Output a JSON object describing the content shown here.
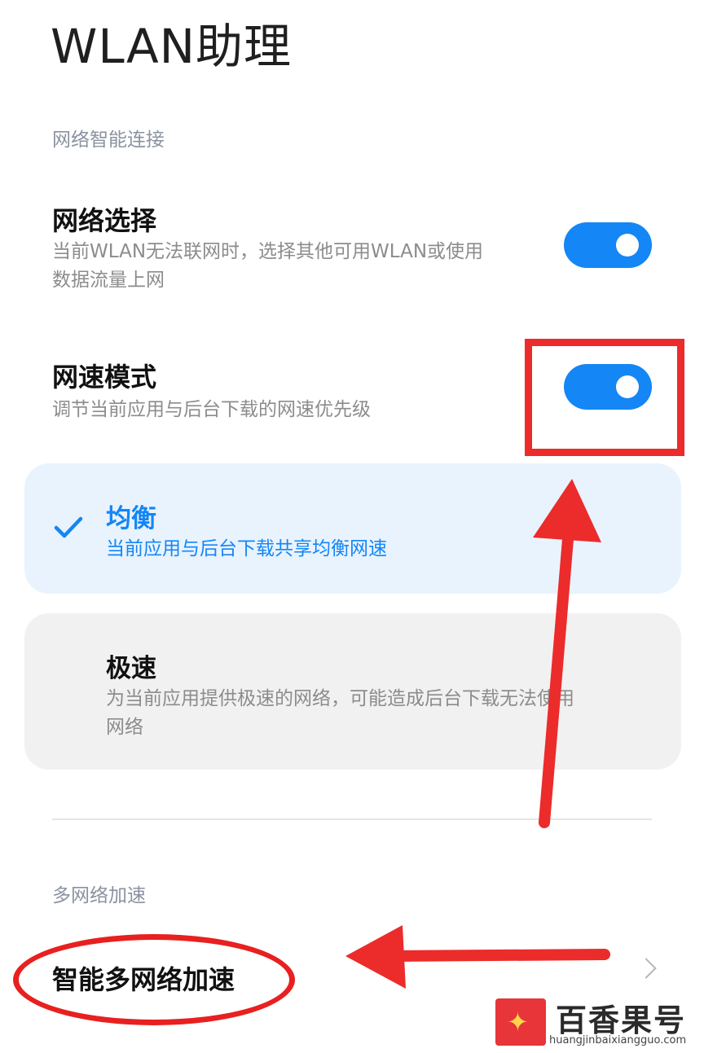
{
  "page": {
    "title": "WLAN助理"
  },
  "sections": [
    {
      "header": "网络智能连接"
    },
    {
      "header": "多网络加速"
    }
  ],
  "network_select": {
    "title": "网络选择",
    "desc_line1": "当前WLAN无法联网时，选择其他可用WLAN或使用",
    "desc_line2": "数据流量上网",
    "enabled": true
  },
  "speed_mode": {
    "title": "网速模式",
    "desc": "调节当前应用与后台下载的网速优先级",
    "enabled": true
  },
  "speed_options": [
    {
      "title": "均衡",
      "desc_line1": "当前应用与后台下载共享均衡网速",
      "desc_line2": "",
      "selected": true
    },
    {
      "title": "极速",
      "desc_line1": "为当前应用提供极速的网络，可能造成后台下载无法使用",
      "desc_line2": "网络",
      "selected": false
    }
  ],
  "multi_network": {
    "title": "智能多网络加速"
  },
  "icons": {
    "check": "check-icon",
    "chevron": "chevron-right-icon"
  },
  "colors": {
    "accent": "#1486f5",
    "annotation": "#ec2b2b",
    "selected_bg": "#e8f3fe"
  },
  "watermark": {
    "name": "百香果号",
    "url": "huangjinbaixiangguo.com"
  }
}
